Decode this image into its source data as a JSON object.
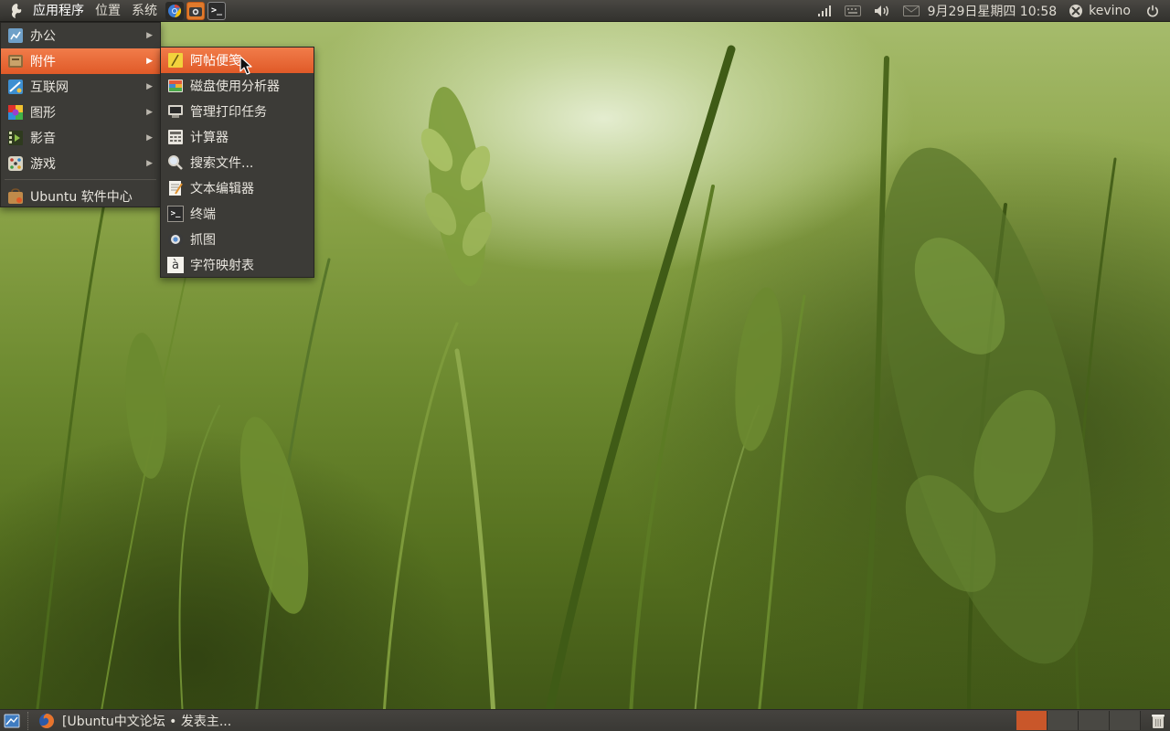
{
  "top_panel": {
    "menus": [
      {
        "label": "应用程序"
      },
      {
        "label": "位置"
      },
      {
        "label": "系统"
      }
    ],
    "launchers": [
      "chromium-icon",
      "screenshot-icon",
      "terminal-icon"
    ],
    "terminal_glyph": ">_",
    "clock": "9月29日星期四 10:58",
    "user": "kevino",
    "status_icons": [
      "network-signal-icon",
      "keyboard-icon",
      "volume-icon",
      "mail-icon",
      "user-status-icon",
      "power-icon"
    ]
  },
  "applications_menu": {
    "items": [
      {
        "label": "办公",
        "icon": "office-icon",
        "has_submenu": true
      },
      {
        "label": "附件",
        "icon": "accessories-icon",
        "has_submenu": true,
        "highlighted": true
      },
      {
        "label": "互联网",
        "icon": "internet-icon",
        "has_submenu": true
      },
      {
        "label": "图形",
        "icon": "graphics-icon",
        "has_submenu": true
      },
      {
        "label": "影音",
        "icon": "multimedia-icon",
        "has_submenu": true
      },
      {
        "label": "游戏",
        "icon": "games-icon",
        "has_submenu": true
      }
    ],
    "software_center": {
      "label": "Ubuntu 软件中心",
      "icon": "software-center-icon"
    }
  },
  "accessories_submenu": {
    "items": [
      {
        "label": "阿帖便笺",
        "icon": "sticky-notes-icon",
        "highlighted": true
      },
      {
        "label": "磁盘使用分析器",
        "icon": "disk-usage-icon"
      },
      {
        "label": "管理打印任务",
        "icon": "printer-icon"
      },
      {
        "label": "计算器",
        "icon": "calculator-icon"
      },
      {
        "label": "搜索文件...",
        "icon": "search-icon"
      },
      {
        "label": "文本编辑器",
        "icon": "text-editor-icon"
      },
      {
        "label": "终端",
        "icon": "terminal-icon"
      },
      {
        "label": "抓图",
        "icon": "screenshot-icon"
      },
      {
        "label": "字符映射表",
        "icon": "character-map-icon"
      }
    ],
    "terminal_glyph": ">_",
    "charmap_glyph": "à"
  },
  "bottom_panel": {
    "task": {
      "label": "[Ubuntu中文论坛 • 发表主...",
      "icon": "firefox-icon"
    },
    "workspaces": {
      "count": 4,
      "active_index": 0
    },
    "trash_icon": "trash-icon",
    "show_desktop_icon": "show-desktop-icon"
  },
  "colors": {
    "highlight": "#e8622f",
    "panel": "#3c3b37",
    "menu_text": "#e8e5de"
  }
}
